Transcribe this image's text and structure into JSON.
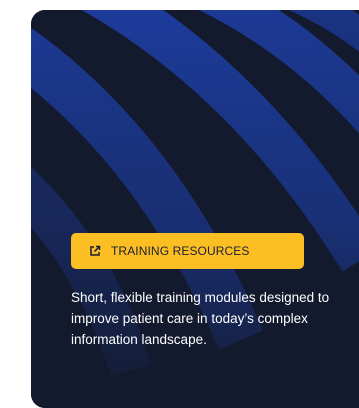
{
  "card": {
    "badge": {
      "icon": "external-link-icon",
      "label": "TRAINING RESOURCES"
    },
    "description": "Short, flexible training modules designed to improve patient care in today’s complex information landscape."
  },
  "colors": {
    "card_background": "#141a2e",
    "stripe_blue": "#1d3fa6",
    "badge_background": "#fbbf24",
    "badge_text": "#1a1f33",
    "description_text": "#ffffff"
  }
}
